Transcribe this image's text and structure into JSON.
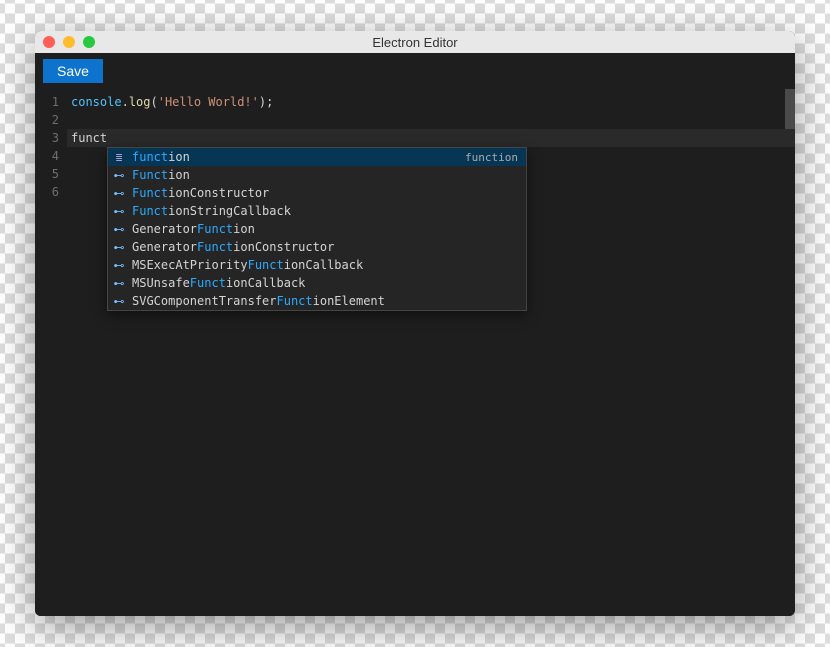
{
  "window": {
    "title": "Electron Editor"
  },
  "toolbar": {
    "save_label": "Save"
  },
  "editor": {
    "gutter": [
      "1",
      "2",
      "3",
      "4",
      "5",
      "6"
    ],
    "line1": {
      "obj": "console",
      "dot": ".",
      "method": "log",
      "open": "(",
      "str": "'Hello World!'",
      "close": ");"
    },
    "typed": "funct"
  },
  "autocomplete": {
    "hint": "function",
    "items": [
      {
        "pre": "",
        "match": "funct",
        "post": "ion",
        "icon": "keyword",
        "selected": true
      },
      {
        "pre": "",
        "match": "Funct",
        "post": "ion",
        "icon": "interface",
        "selected": false
      },
      {
        "pre": "",
        "match": "Funct",
        "post": "ionConstructor",
        "icon": "interface",
        "selected": false
      },
      {
        "pre": "",
        "match": "Funct",
        "post": "ionStringCallback",
        "icon": "interface",
        "selected": false
      },
      {
        "pre": "Generator",
        "match": "Funct",
        "post": "ion",
        "icon": "interface",
        "selected": false
      },
      {
        "pre": "Generator",
        "match": "Funct",
        "post": "ionConstructor",
        "icon": "interface",
        "selected": false
      },
      {
        "pre": "MSExecAtPriority",
        "match": "Funct",
        "post": "ionCallback",
        "icon": "interface",
        "selected": false
      },
      {
        "pre": "MSUnsafe",
        "match": "Funct",
        "post": "ionCallback",
        "icon": "interface",
        "selected": false
      },
      {
        "pre": "SVGComponentTransfer",
        "match": "Funct",
        "post": "ionElement",
        "icon": "interface",
        "selected": false
      }
    ]
  }
}
